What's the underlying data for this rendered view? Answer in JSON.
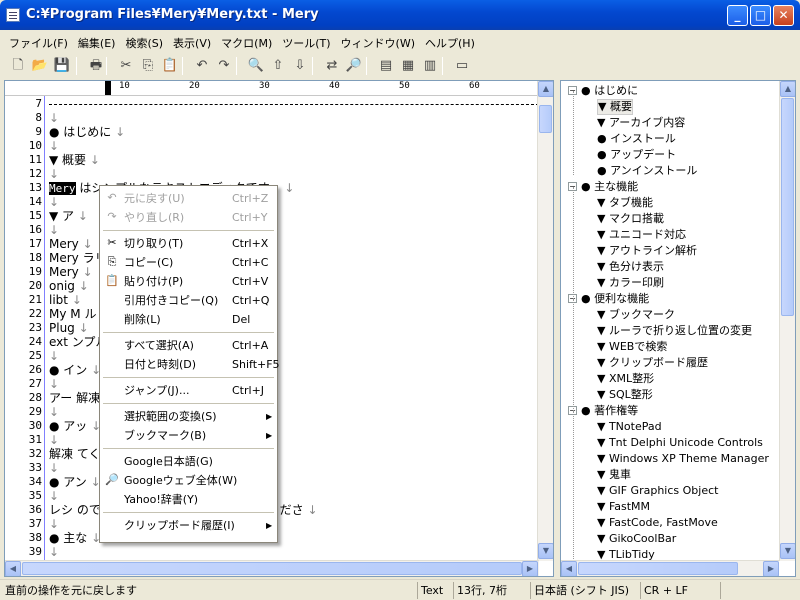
{
  "window": {
    "title": "C:¥Program Files¥Mery¥Mery.txt - Mery",
    "min": "_",
    "max": "□",
    "close": "✕"
  },
  "menu": [
    "ファイル(F)",
    "編集(E)",
    "検索(S)",
    "表示(V)",
    "マクロ(M)",
    "ツール(T)",
    "ウィンドウ(W)",
    "ヘルプ(H)"
  ],
  "toolbar": [
    "new-file-icon",
    "open-folder-icon",
    "save-icon",
    "print-icon",
    "cut-icon",
    "copy-icon",
    "paste-icon",
    "undo-icon",
    "redo-icon",
    "find-icon",
    "find-up-icon",
    "find-down-icon",
    "replace-icon",
    "search-web-icon",
    "view-normal-icon",
    "view-outline-icon",
    "view-book-icon",
    "ruler-icon"
  ],
  "ruler": [
    "10",
    "20",
    "30",
    "40",
    "50",
    "60"
  ],
  "editor": {
    "lines": [
      {
        "n": "7",
        "t": "",
        "dash": true
      },
      {
        "n": "8",
        "t": ""
      },
      {
        "n": "9",
        "t": "● はじめに"
      },
      {
        "n": "10",
        "t": ""
      },
      {
        "n": "11",
        "t": "  ▼ 概要"
      },
      {
        "n": "12",
        "t": ""
      },
      {
        "n": "13",
        "t": "    Mery はシンプルなテキストエディタです。",
        "sel": "Mery"
      },
      {
        "n": "14",
        "t": ""
      },
      {
        "n": "15",
        "t": "  ▼ ア"
      },
      {
        "n": "16",
        "t": ""
      },
      {
        "n": "17",
        "t": "    Mery"
      },
      {
        "n": "18",
        "t": "    Mery                ラリ"
      },
      {
        "n": "19",
        "t": "    Mery"
      },
      {
        "n": "20",
        "t": "    onig"
      },
      {
        "n": "21",
        "t": "    libt"
      },
      {
        "n": "22",
        "t": "    My M                      ル"
      },
      {
        "n": "23",
        "t": "    Plug"
      },
      {
        "n": "24",
        "t": "    ext                        ンプル"
      },
      {
        "n": "25",
        "t": ""
      },
      {
        "n": "26",
        "t": "● イン"
      },
      {
        "n": "27",
        "t": ""
      },
      {
        "n": "28",
        "t": "    アー                      解凍します。"
      },
      {
        "n": "29",
        "t": ""
      },
      {
        "n": "30",
        "t": "● アッ"
      },
      {
        "n": "31",
        "t": ""
      },
      {
        "n": "32",
        "t": "    解凍                      てください。"
      },
      {
        "n": "33",
        "t": ""
      },
      {
        "n": "34",
        "t": "● アン"
      },
      {
        "n": "35",
        "t": ""
      },
      {
        "n": "36",
        "t": "    レシ                      ので、解凍したフォルダを削除してくださ"
      },
      {
        "n": "37",
        "t": ""
      },
      {
        "n": "38",
        "t": "● 主な"
      },
      {
        "n": "39",
        "t": ""
      }
    ]
  },
  "context_menu": [
    {
      "label": "元に戻す(U)",
      "acc": "Ctrl+Z",
      "disabled": true,
      "icon": "undo-icon"
    },
    {
      "label": "やり直し(R)",
      "acc": "Ctrl+Y",
      "disabled": true,
      "icon": "redo-icon"
    },
    {
      "sep": true
    },
    {
      "label": "切り取り(T)",
      "acc": "Ctrl+X",
      "icon": "cut-icon"
    },
    {
      "label": "コピー(C)",
      "acc": "Ctrl+C",
      "icon": "copy-icon"
    },
    {
      "label": "貼り付け(P)",
      "acc": "Ctrl+V",
      "icon": "paste-icon"
    },
    {
      "label": "引用付きコピー(Q)",
      "acc": "Ctrl+Q"
    },
    {
      "label": "削除(L)",
      "acc": "Del"
    },
    {
      "sep": true
    },
    {
      "label": "すべて選択(A)",
      "acc": "Ctrl+A"
    },
    {
      "label": "日付と時刻(D)",
      "acc": "Shift+F5"
    },
    {
      "sep": true
    },
    {
      "label": "ジャンプ(J)...",
      "acc": "Ctrl+J"
    },
    {
      "sep": true
    },
    {
      "label": "選択範囲の変換(S)",
      "sub": true
    },
    {
      "label": "ブックマーク(B)",
      "sub": true
    },
    {
      "sep": true
    },
    {
      "label": "Google日本語(G)"
    },
    {
      "label": "Googleウェブ全体(W)",
      "icon": "search-web-icon"
    },
    {
      "label": "Yahoo!辞書(Y)"
    },
    {
      "sep": true
    },
    {
      "label": "クリップボード履歴(I)",
      "sub": true
    }
  ],
  "outline": [
    {
      "lvl": 0,
      "exp": "−",
      "t": "● はじめに"
    },
    {
      "lvl": 1,
      "t": "▼ 概要",
      "hl": true
    },
    {
      "lvl": 1,
      "t": "▼ アーカイブ内容"
    },
    {
      "lvl": 1,
      "t": "● インストール"
    },
    {
      "lvl": 1,
      "t": "● アップデート"
    },
    {
      "lvl": 1,
      "t": "● アンインストール"
    },
    {
      "lvl": 0,
      "exp": "−",
      "t": "● 主な機能"
    },
    {
      "lvl": 1,
      "t": "▼ タブ機能"
    },
    {
      "lvl": 1,
      "t": "▼ マクロ搭載"
    },
    {
      "lvl": 1,
      "t": "▼ ユニコード対応"
    },
    {
      "lvl": 1,
      "t": "▼ アウトライン解析"
    },
    {
      "lvl": 1,
      "t": "▼ 色分け表示"
    },
    {
      "lvl": 1,
      "t": "▼ カラー印刷"
    },
    {
      "lvl": 0,
      "exp": "−",
      "t": "● 便利な機能"
    },
    {
      "lvl": 1,
      "t": "▼ ブックマーク"
    },
    {
      "lvl": 1,
      "t": "▼ ルーラで折り返し位置の変更"
    },
    {
      "lvl": 1,
      "t": "▼ WEBで検索"
    },
    {
      "lvl": 1,
      "t": "▼ クリップボード履歴"
    },
    {
      "lvl": 1,
      "t": "▼ XML整形"
    },
    {
      "lvl": 1,
      "t": "▼ SQL整形"
    },
    {
      "lvl": 0,
      "exp": "−",
      "t": "● 著作権等"
    },
    {
      "lvl": 1,
      "t": "▼ TNotePad"
    },
    {
      "lvl": 1,
      "t": "▼ Tnt Delphi Unicode Controls"
    },
    {
      "lvl": 1,
      "t": "▼ Windows XP Theme Manager"
    },
    {
      "lvl": 1,
      "t": "▼ 鬼車"
    },
    {
      "lvl": 1,
      "t": "▼ GIF Graphics Object"
    },
    {
      "lvl": 1,
      "t": "▼ FastMM"
    },
    {
      "lvl": 1,
      "t": "▼ FastCode, FastMove"
    },
    {
      "lvl": 1,
      "t": "▼ GikoCoolBar"
    },
    {
      "lvl": 1,
      "t": "▼ TLibTidy"
    }
  ],
  "status": {
    "message": "直前の操作を元に戻します",
    "mode": "Text",
    "pos": "13行, 7桁",
    "encoding": "日本語 (シフト JIS)",
    "eol": "CR + LF"
  }
}
